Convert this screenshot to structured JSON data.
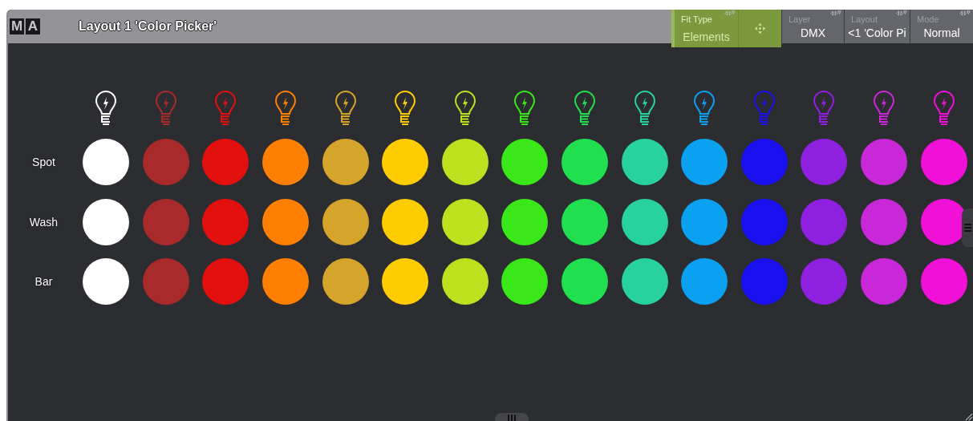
{
  "window": {
    "logo": [
      "M",
      "A"
    ],
    "title": "Layout 1 'Color Picker'"
  },
  "toolbar": [
    {
      "kind": "field",
      "label": "Fit Type",
      "value": "Elements",
      "active": true
    },
    {
      "kind": "move",
      "active": true
    },
    {
      "kind": "field",
      "label": "Layer",
      "value": "DMX",
      "active": false
    },
    {
      "kind": "field",
      "label": "Layout",
      "value": "<1 'Color Pi",
      "active": false
    },
    {
      "kind": "field",
      "label": "Mode",
      "value": "Normal",
      "active": false
    }
  ],
  "colors": [
    {
      "color": "#ffffff"
    },
    {
      "color": "#a82a2a"
    },
    {
      "color": "#e31010"
    },
    {
      "color": "#ff7f00"
    },
    {
      "color": "#d4a52a"
    },
    {
      "color": "#ffcc00"
    },
    {
      "color": "#bde01f"
    },
    {
      "color": "#3ae81a"
    },
    {
      "color": "#20e04f"
    },
    {
      "color": "#28d2a0"
    },
    {
      "color": "#0aa2f0"
    },
    {
      "color": "#1a10f0"
    },
    {
      "color": "#9020e0"
    },
    {
      "color": "#c828d8"
    },
    {
      "color": "#f010d8"
    }
  ],
  "rows": [
    {
      "label": "Spot"
    },
    {
      "label": "Wash"
    },
    {
      "label": "Bar"
    }
  ]
}
